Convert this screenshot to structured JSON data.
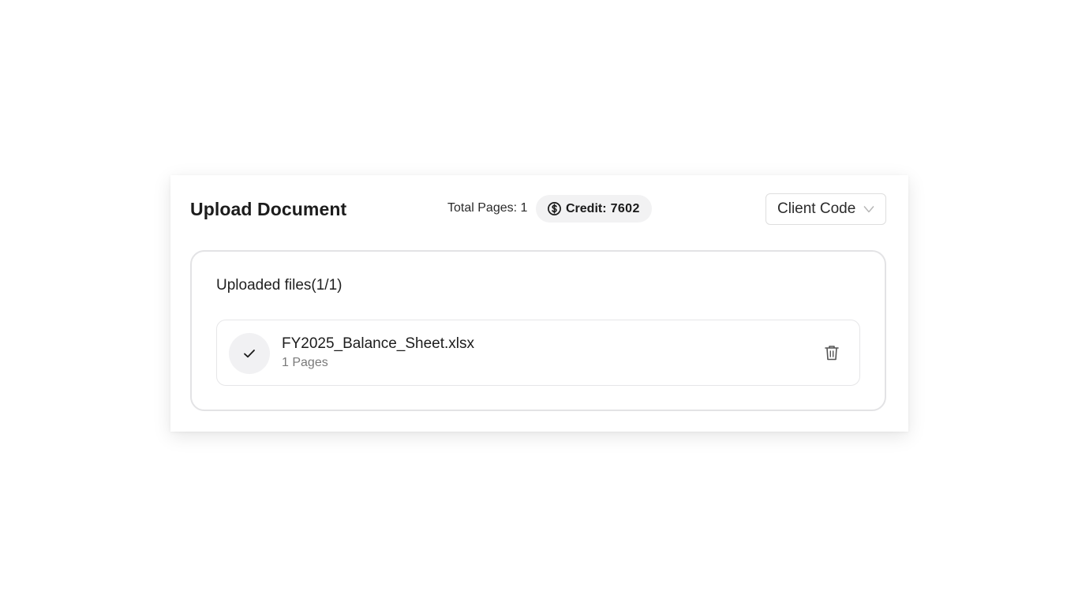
{
  "header": {
    "title": "Upload Document",
    "total_pages_text": "Total Pages: 1",
    "credit_label": "Credit:",
    "credit_value": "7602",
    "credit_icon": "dollar-circle-icon",
    "client_select": {
      "label": "Client Code",
      "icon": "chevron-down-icon"
    }
  },
  "uploaded": {
    "heading": "Uploaded files(1/1)",
    "files": [
      {
        "name": "FY2025_Balance_Sheet.xlsx",
        "pages": "1 Pages",
        "status_icon": "check-icon",
        "action_icon": "trash-icon"
      }
    ]
  },
  "colors": {
    "background": "#ffffff",
    "pill_bg": "#f2f2f3",
    "border": "#e3e3e5",
    "muted_text": "#7a7a7a"
  }
}
